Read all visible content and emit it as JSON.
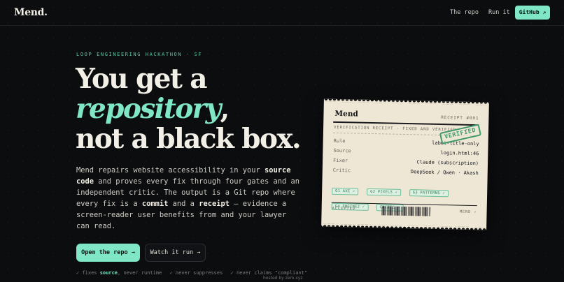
{
  "nav": {
    "logo": "Mend.",
    "links": [
      "The repo",
      "Run it"
    ],
    "github_label": "GitHub ↗"
  },
  "hero": {
    "eyebrow": "LOOP ENGINEERING HACKATHON · SF",
    "headline_line1": "You get a",
    "headline_accent": "repository",
    "headline_comma": ",",
    "headline_line3": "not a black box.",
    "desc": {
      "p1": "Mend repairs website accessibility in your ",
      "b1": "source code",
      "p2": " and proves every fix through four gates and an independent critic. The output is a Git repo where every fix is a ",
      "b2": "commit",
      "p3": " and a ",
      "b3": "receipt",
      "p4": " — evidence a screen-reader user benefits from and your lawyer can read."
    },
    "primary_button": "Open the repo →",
    "secondary_button": "Watch it run →",
    "checks": {
      "c1_pre": "✓ fixes ",
      "c1_bold": "source",
      "c1_post": ", never runtime",
      "c2": "✓ never suppresses",
      "c3": "✓ never claims \"compliant\""
    }
  },
  "receipt": {
    "brand": "Mend",
    "number": "RECEIPT #001",
    "subtitle": "VERIFICATION RECEIPT · FIXED AND VERIFIED",
    "stamp": "VERIFIED",
    "rows": [
      {
        "key": "Rule",
        "value": "label-title-only"
      },
      {
        "key": "Source",
        "value": "login.html:46"
      },
      {
        "key": "Fixer",
        "value": "Claude (subscription)"
      },
      {
        "key": "Critic",
        "value": "DeepSeek / Qwen · Akash"
      }
    ],
    "chips": [
      "G1 AXE ✓",
      "G2 PIXELS ✓",
      "G3 PATTERNS ✓",
      "G4 ENGINE2 ✓",
      "CRITIC ✓"
    ],
    "accepted": "ACCEPTED",
    "footer_right": "MEND ✓"
  },
  "footer": {
    "hosted": "hosted by zero.xyz"
  },
  "colors": {
    "background": "#0c0d0f",
    "accent": "#7fe6c6",
    "paper": "#efe7d6",
    "stamp_green": "#3e9a6a"
  }
}
